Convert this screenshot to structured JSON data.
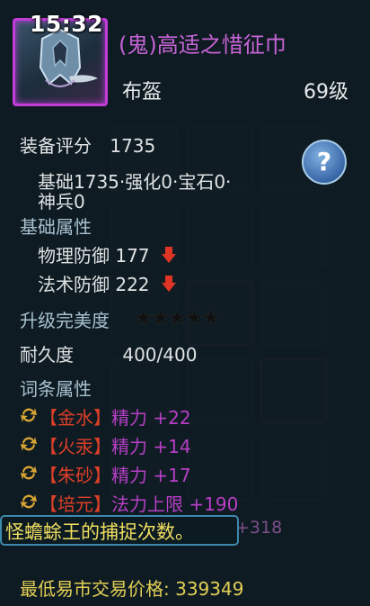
{
  "status": {
    "time": "15:32"
  },
  "item": {
    "name": "(鬼)高适之惜征巾",
    "type": "布盔",
    "level": "69级",
    "icon": "helmet-icon"
  },
  "score": {
    "label": "装备评分",
    "value": "1735"
  },
  "score_breakdown": {
    "line1": "基础1735·强化0·宝石0·",
    "line2": "神兵0"
  },
  "base_attrs": {
    "title": "基础属性",
    "items": [
      {
        "label": "物理防御",
        "value": "177",
        "trend": "down"
      },
      {
        "label": "法术防御",
        "value": "222",
        "trend": "down"
      }
    ]
  },
  "perfection": {
    "label": "升级完美度",
    "stars_total": 5,
    "stars_filled": 0
  },
  "durability": {
    "label": "耐久度",
    "value": "400/400"
  },
  "affixes": {
    "title": "词条属性",
    "items": [
      {
        "tag": "【金水】",
        "text": "精力 +22"
      },
      {
        "tag": "【火汞】",
        "text": "精力 +14"
      },
      {
        "tag": "【朱砂】",
        "text": "精力 +17"
      },
      {
        "tag": "【培元】",
        "text": "法力上限 +190"
      }
    ]
  },
  "notice": {
    "text": "怪蟾蜍王的捕捉次数。",
    "partial": "+318"
  },
  "market": {
    "label": "最低易市交易价格:",
    "value": "339349"
  },
  "help_label": "?",
  "colors": {
    "accent": "#c23cd8",
    "affix_tag": "#dc3f28",
    "affix_value": "#b63fc6",
    "price": "#e2cf55",
    "down_arrow": "#e03524"
  }
}
